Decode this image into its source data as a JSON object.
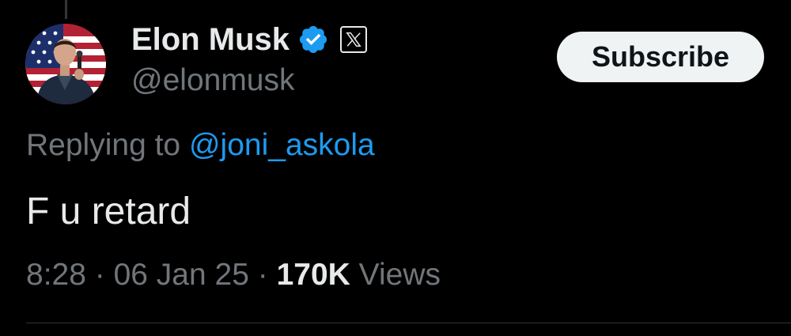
{
  "author": {
    "display_name": "Elon Musk",
    "handle": "@elonmusk",
    "verified_icon": "verified-badge-icon",
    "affiliate_icon": "x-logo-icon"
  },
  "subscribe_label": "Subscribe",
  "reply": {
    "prefix": "Replying to",
    "target": "@joni_askola"
  },
  "tweet_text": "F u retard",
  "meta": {
    "time": "8:28",
    "separator": "·",
    "date": "06 Jan 25",
    "views_count": "170K",
    "views_label": "Views"
  },
  "colors": {
    "background": "#000000",
    "primary_text": "#e7e9ea",
    "secondary_text": "#71767b",
    "link": "#1d9bf0",
    "verified": "#1d9bf0",
    "button_bg": "#eff3f4"
  }
}
